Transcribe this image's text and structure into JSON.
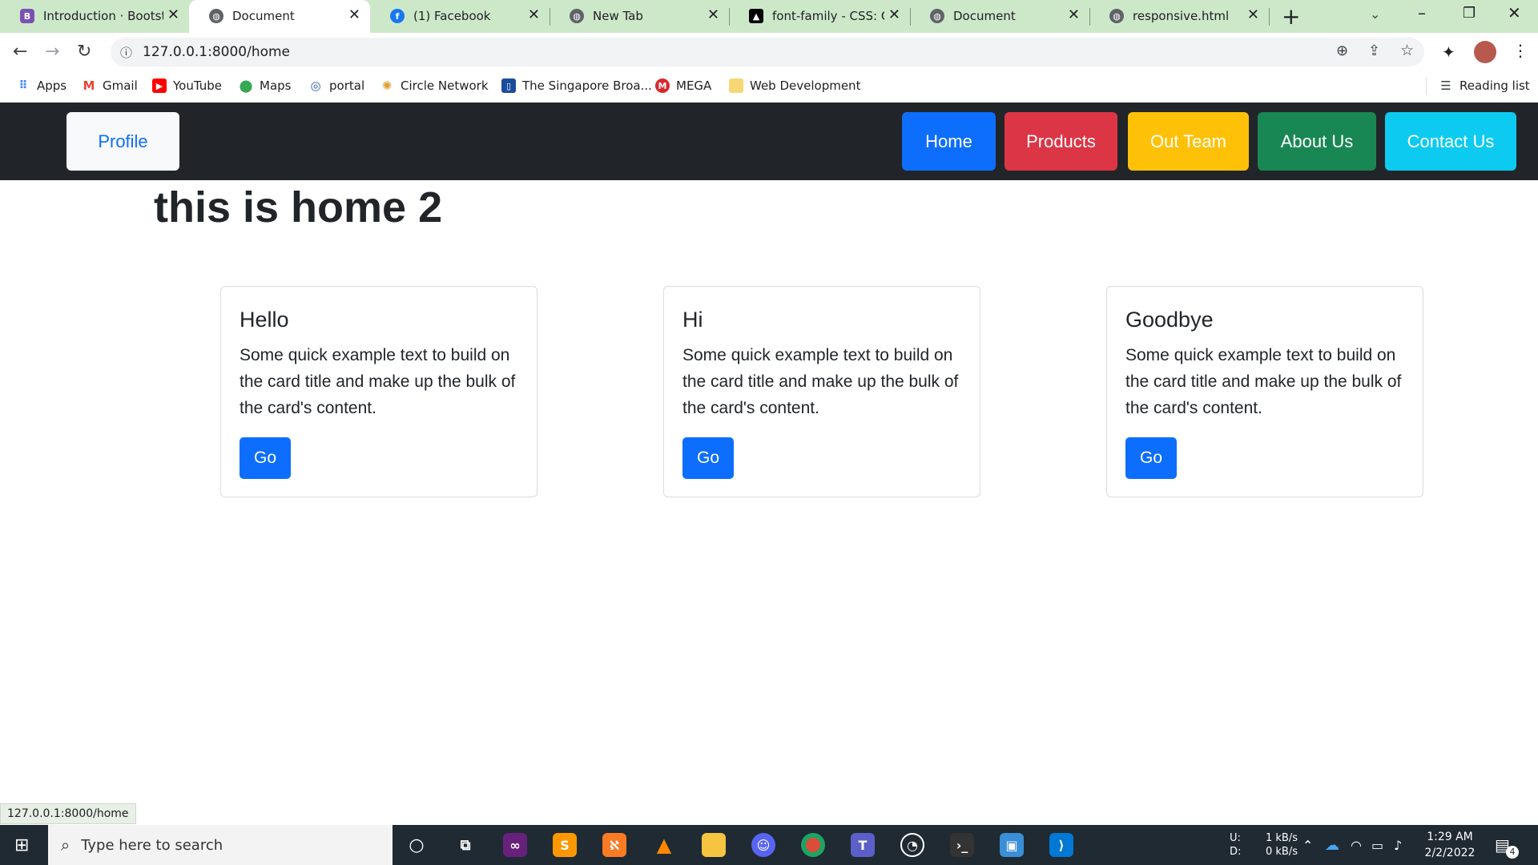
{
  "browser": {
    "tabs": [
      {
        "label": "Introduction · Bootstrap",
        "icon": "bootstrap-icon"
      },
      {
        "label": "Document",
        "icon": "globe-icon"
      },
      {
        "label": "(1) Facebook",
        "icon": "facebook-icon"
      },
      {
        "label": "New Tab",
        "icon": "chrome-icon"
      },
      {
        "label": "font-family - CSS: Cas",
        "icon": "mdn-icon"
      },
      {
        "label": "Document",
        "icon": "globe-icon"
      },
      {
        "label": "responsive.html",
        "icon": "globe-icon"
      }
    ],
    "url": "127.0.0.1:8000/home",
    "reading_list": "Reading list",
    "bookmarks": [
      {
        "label": "Apps",
        "icon": "apps-icon"
      },
      {
        "label": "Gmail",
        "icon": "gmail-icon"
      },
      {
        "label": "YouTube",
        "icon": "youtube-icon"
      },
      {
        "label": "Maps",
        "icon": "maps-icon"
      },
      {
        "label": "portal",
        "icon": "portal-icon"
      },
      {
        "label": "Circle Network",
        "icon": "circle-network-icon"
      },
      {
        "label": "The Singapore Broa...",
        "icon": "singapore-icon"
      },
      {
        "label": "MEGA",
        "icon": "mega-icon"
      },
      {
        "label": "Web Development",
        "icon": "folder-icon"
      }
    ]
  },
  "navbar": {
    "profile": "Profile",
    "home": "Home",
    "products": "Products",
    "team": "Out Team",
    "about": "About Us",
    "contact": "Contact Us"
  },
  "page": {
    "heading": "this is home 2",
    "cards": [
      {
        "title": "Hello",
        "text": "Some quick example text to build on the card title and make up the bulk of the card's content.",
        "button": "Go"
      },
      {
        "title": "Hi",
        "text": "Some quick example text to build on the card title and make up the bulk of the card's content.",
        "button": "Go"
      },
      {
        "title": "Goodbye",
        "text": "Some quick example text to build on the card title and make up the bulk of the card's content.",
        "button": "Go"
      }
    ]
  },
  "status_url": "127.0.0.1:8000/home",
  "taskbar": {
    "search_placeholder": "Type here to search",
    "net_up_label": "U:",
    "net_down_label": "D:",
    "net_up": "1 kB/s",
    "net_down": "0 kB/s",
    "time": "1:29 AM",
    "date": "2/2/2022",
    "notifications": "4"
  },
  "colors": {
    "home": "#0d6efd",
    "products": "#dc3545",
    "team": "#ffc107",
    "about": "#198754",
    "contact": "#0dcaf0",
    "navbar": "#212529",
    "tabstrip": "#cde8c9"
  }
}
